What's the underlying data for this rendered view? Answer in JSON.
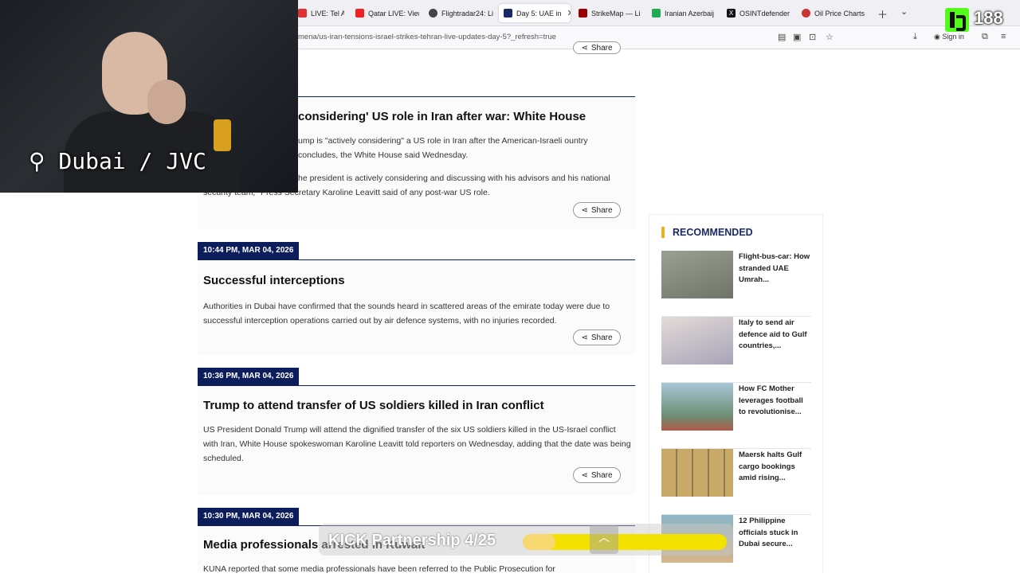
{
  "browser": {
    "tabs": [
      {
        "label": "LIVE: Tel Aviv an",
        "fav": "#d33"
      },
      {
        "label": "Qatar LIVE: View",
        "fav": "#e22"
      },
      {
        "label": "Flightradar24: Li",
        "fav": "#444"
      },
      {
        "label": "Day 5: UAE in",
        "fav": "#1a2a66",
        "active": true
      },
      {
        "label": "StrikeMap — Li",
        "fav": "#900"
      },
      {
        "label": "Iranian Azerbaij",
        "fav": "#2a5"
      },
      {
        "label": "OSINTdefender",
        "fav": "#111"
      },
      {
        "label": "Oil Price Charts",
        "fav": "#c33"
      }
    ],
    "url": "mena/us-iran-tensions-israel-strikes-tehran-live-updates-day-5?_refresh=true",
    "sign_in": "Sign in"
  },
  "stream": {
    "location_label": "⚲ Dubai / JVC",
    "viewer_count": "188",
    "partnership_label": "KICK Partnership 4/25",
    "partnership_progress": 0.16
  },
  "share_label": "Share",
  "posts": [
    {
      "headline": "considering' US role in Iran after war: White House",
      "paras": [
        "ump is \"actively considering\" a US role in Iran after the American-Israeli ountry concludes, the White House said Wednesday.",
        "he president is actively considering and discussing with his advisors and his national security team,\" Press Secretary Karoline Leavitt said of any post-war US role."
      ]
    },
    {
      "stamp": "10:44 PM, MAR 04, 2026",
      "headline": "Successful interceptions",
      "paras": [
        "Authorities in Dubai have confirmed that the sounds heard in scattered areas of the emirate today were due to successful interception operations carried out by air defence systems, with no injuries recorded."
      ]
    },
    {
      "stamp": "10:36 PM, MAR 04, 2026",
      "headline": "Trump to attend transfer of US soldiers killed in Iran conflict",
      "paras": [
        "US President Donald Trump will attend the dignified transfer of the six US soldiers killed in the US-Israel conflict with Iran, White House spokeswoman Karoline Leavitt told reporters on Wednesday, adding that the date was being scheduled."
      ]
    },
    {
      "stamp": "10:30 PM, MAR 04, 2026",
      "headline": "Media professionals arrested in Kuwait",
      "paras": [
        "KUNA reported that some media professionals have been referred to the Public Prosecution for"
      ]
    }
  ],
  "recommended": {
    "title": "RECOMMENDED",
    "items": [
      {
        "text": "Flight-bus-car: How stranded UAE Umrah...",
        "thumb": "#8a8f86"
      },
      {
        "text": "Italy to send air defence aid to Gulf countries,...",
        "thumb": "#c9c2bf"
      },
      {
        "text": "How FC Mother leverages football to revolutionise...",
        "thumb": "#7fa7b8"
      },
      {
        "text": "Maersk halts Gulf cargo bookings amid rising...",
        "thumb": "#b7a070"
      },
      {
        "text": "12 Philippine officials stuck in Dubai secure...",
        "thumb": "#6d9cb0"
      }
    ]
  }
}
